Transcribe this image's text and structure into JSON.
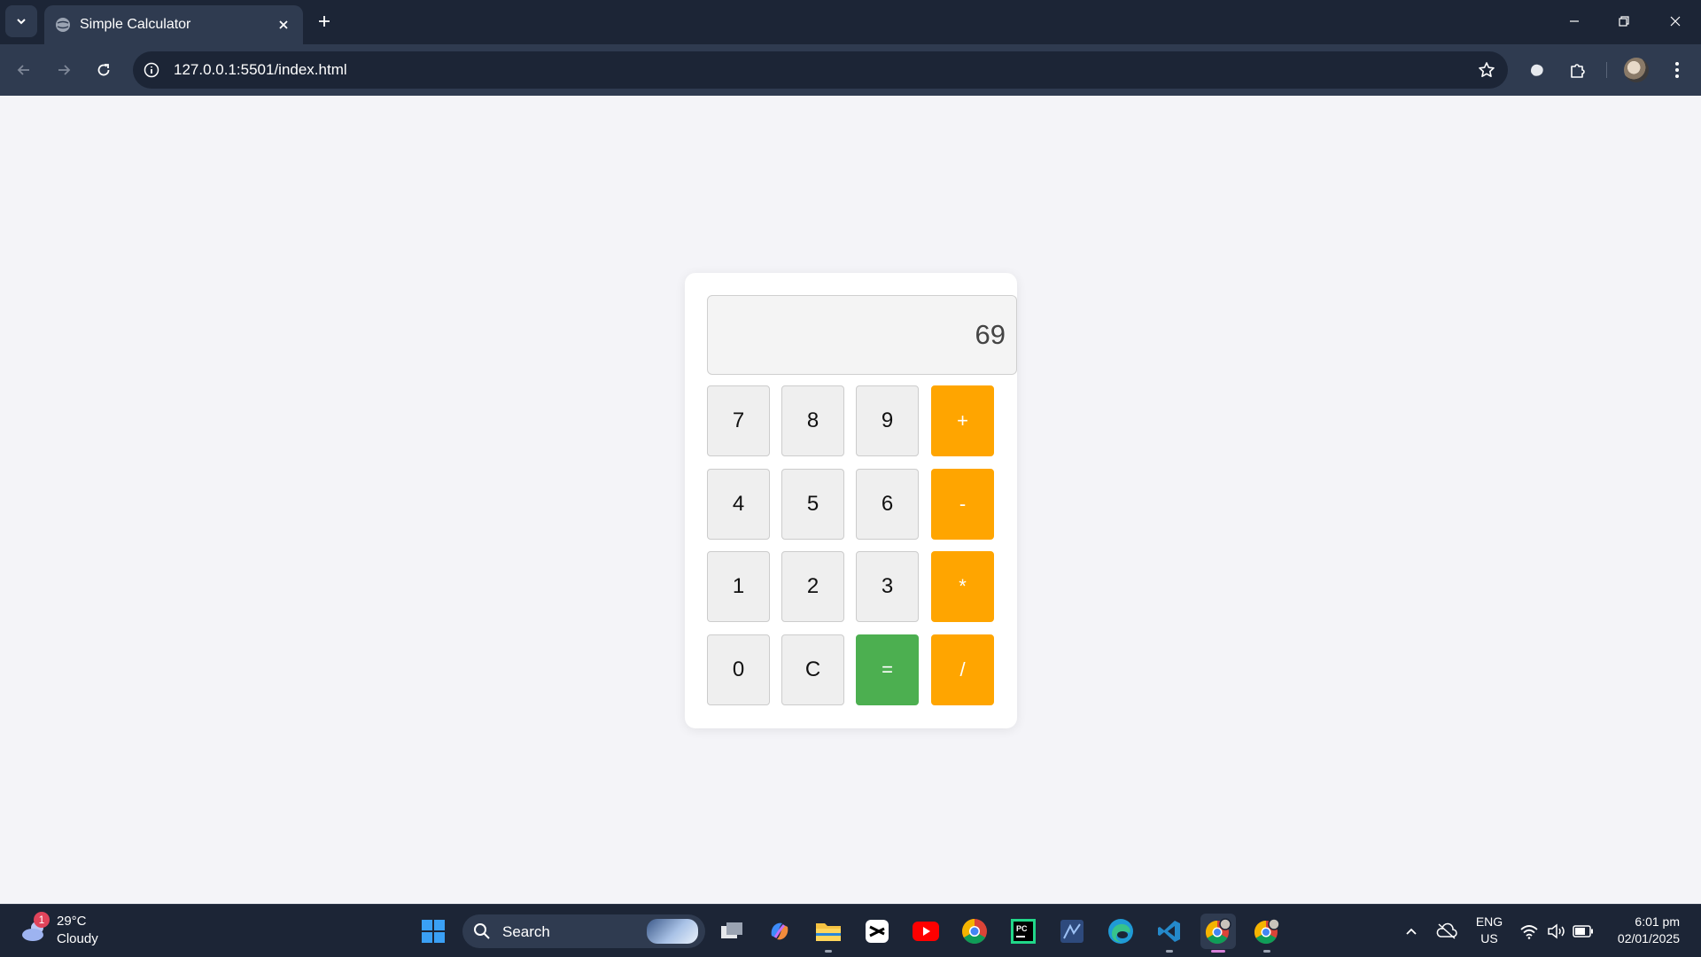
{
  "browser": {
    "tab_title": "Simple Calculator",
    "url": "127.0.0.1:5501/index.html"
  },
  "calculator": {
    "display_value": "69",
    "keys": [
      {
        "label": "7",
        "type": "digit"
      },
      {
        "label": "8",
        "type": "digit"
      },
      {
        "label": "9",
        "type": "digit"
      },
      {
        "label": "+",
        "type": "operator"
      },
      {
        "label": "4",
        "type": "digit"
      },
      {
        "label": "5",
        "type": "digit"
      },
      {
        "label": "6",
        "type": "digit"
      },
      {
        "label": "-",
        "type": "operator"
      },
      {
        "label": "1",
        "type": "digit"
      },
      {
        "label": "2",
        "type": "digit"
      },
      {
        "label": "3",
        "type": "digit"
      },
      {
        "label": "*",
        "type": "operator"
      },
      {
        "label": "0",
        "type": "digit"
      },
      {
        "label": "C",
        "type": "clear"
      },
      {
        "label": "=",
        "type": "equals"
      },
      {
        "label": "/",
        "type": "operator"
      }
    ],
    "colors": {
      "operator": "#ffa500",
      "equals": "#4caf50",
      "digit": "#efefef"
    }
  },
  "taskbar": {
    "weather_temp": "29°C",
    "weather_desc": "Cloudy",
    "weather_badge": "1",
    "search_label": "Search",
    "lang_line1": "ENG",
    "lang_line2": "US",
    "time": "6:01 pm",
    "date": "02/01/2025",
    "apps": [
      "start-icon",
      "search-icon",
      "task-view-icon",
      "copilot-icon",
      "file-explorer-icon",
      "capcut-icon",
      "youtube-icon",
      "chrome-icon",
      "pycharm-icon",
      "app-icon",
      "edge-icon",
      "vscode-icon",
      "chrome-profile-icon",
      "chrome-profile-icon"
    ]
  }
}
